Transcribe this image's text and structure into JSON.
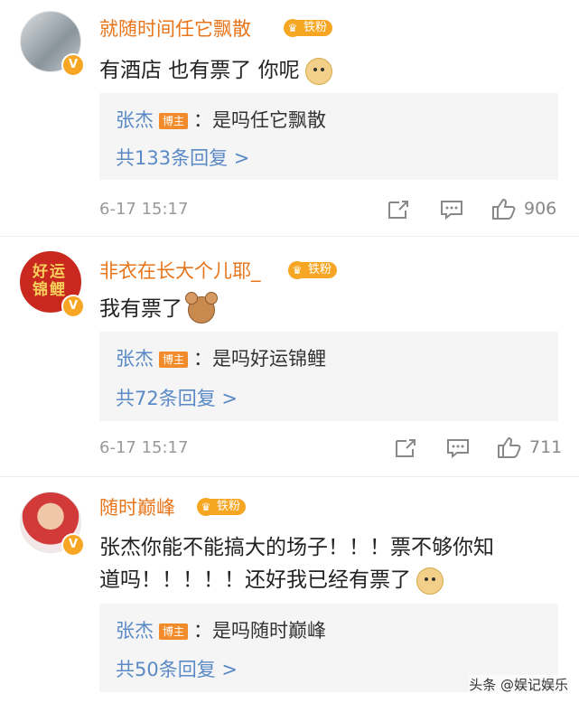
{
  "comments": [
    {
      "username": "就随时间任它飘散",
      "fan_badge": "铁粉",
      "text": "有酒店 也有票了 你呢",
      "emoji": "doge-emoji",
      "reply": {
        "author": "张杰",
        "author_tag": "博主",
        "content": "：是吗任它飘散",
        "more": "共133条回复 >"
      },
      "time": "6-17 15:17",
      "likes": "906"
    },
    {
      "username": "非衣在长大个儿耶_",
      "fan_badge": "铁粉",
      "avatar_text": "好运锦鲤",
      "text": "我有票了",
      "emoji": "jerry-emoji",
      "reply": {
        "author": "张杰",
        "author_tag": "博主",
        "content": "：是吗好运锦鲤",
        "more": "共72条回复 >"
      },
      "time": "6-17 15:17",
      "likes": "711"
    },
    {
      "username": "随时巅峰",
      "fan_badge": "铁粉",
      "text_line1": "张杰你能不能搞大的场子！！！票不够你知",
      "text_line2": "道吗！！！！！还好我已经有票了",
      "emoji": "doge-emoji",
      "reply": {
        "author": "张杰",
        "author_tag": "博主",
        "content": "：是吗随时巅峰",
        "more": "共50条回复 >"
      }
    }
  ],
  "watermark": "头条 @娱记娱乐",
  "colors": {
    "username": "#e8751a",
    "reply_author": "#5a8ac6",
    "badge": "#f6a623",
    "reply_bg": "#f5f5f5",
    "meta": "#999999"
  }
}
